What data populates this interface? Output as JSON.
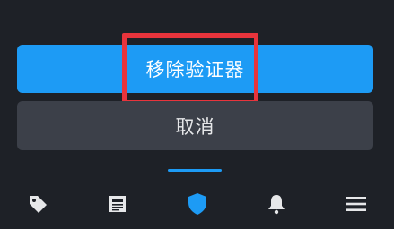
{
  "dialog": {
    "remove_authenticator_label": "移除验证器",
    "cancel_label": "取消"
  },
  "highlight": {
    "target": "remove-authenticator-button",
    "color": "#e8343c"
  },
  "colors": {
    "background": "#1e2127",
    "primary": "#1d9bf5",
    "secondary": "#3c4049",
    "icon_inactive": "#e6e7e9"
  },
  "tabbar": {
    "items": [
      {
        "icon": "tag-icon",
        "active": false
      },
      {
        "icon": "news-icon",
        "active": false
      },
      {
        "icon": "shield-icon",
        "active": true
      },
      {
        "icon": "bell-icon",
        "active": false
      },
      {
        "icon": "menu-icon",
        "active": false
      }
    ]
  }
}
